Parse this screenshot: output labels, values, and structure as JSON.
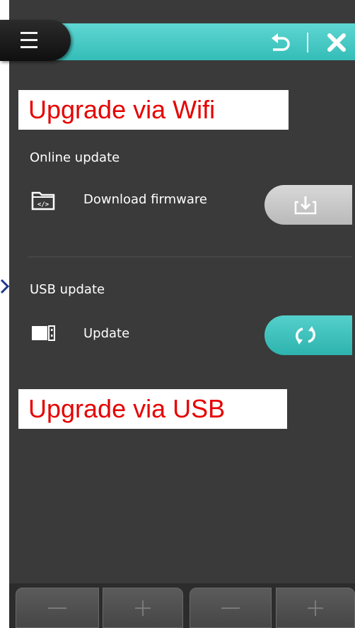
{
  "annotations": {
    "wifi": "Upgrade via Wifi",
    "usb": "Upgrade via USB"
  },
  "header": {
    "menu_icon": "hamburger-menu-icon",
    "back_icon": "undo-arrow-icon",
    "close_icon": "close-x-icon"
  },
  "online_update": {
    "title": "Online update",
    "row_label": "Download firmware",
    "row_icon": "folder-code-icon",
    "button_icon": "download-tray-icon",
    "enabled": false
  },
  "usb_update": {
    "title": "USB update",
    "row_label": "Update",
    "row_icon": "usb-drive-icon",
    "button_icon": "refresh-arrows-icon",
    "enabled": true
  },
  "bottom_bar": {
    "buttons": [
      {
        "icon": "minus-icon"
      },
      {
        "icon": "plus-icon"
      },
      {
        "icon": "minus-icon"
      },
      {
        "icon": "plus-icon"
      }
    ]
  },
  "colors": {
    "accent": "#3cc4bf",
    "background": "#3a3a3a",
    "annotation_text": "#e60000",
    "disabled_button": "#c8c8c8"
  }
}
